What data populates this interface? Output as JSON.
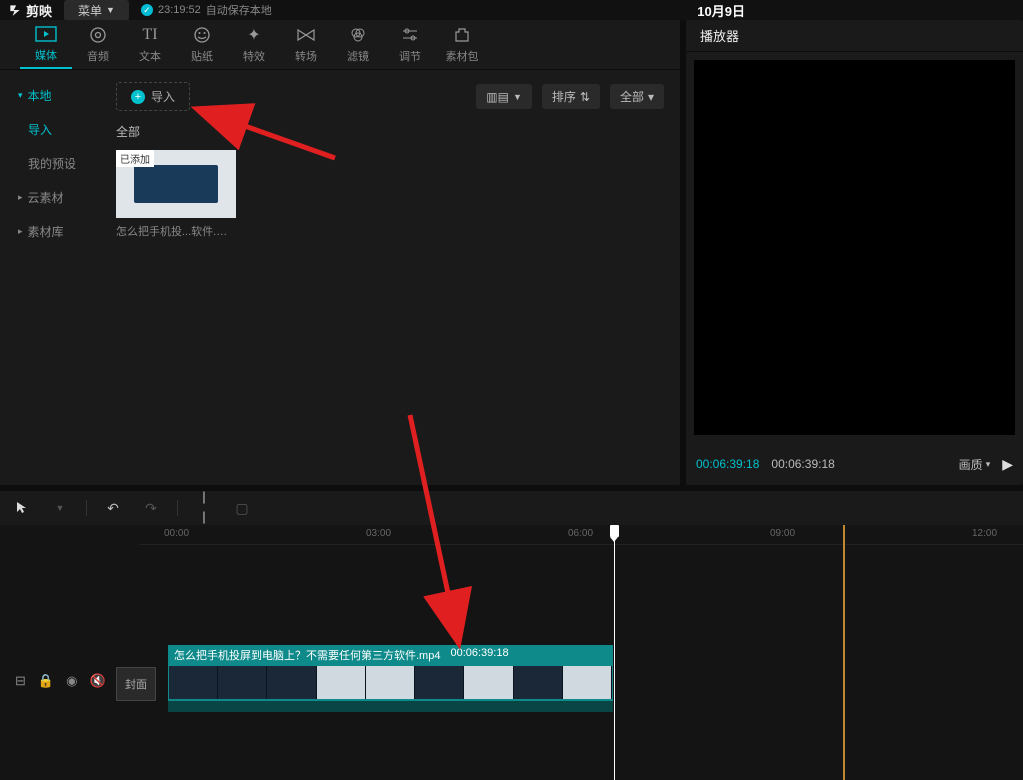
{
  "topbar": {
    "app_name": "剪映",
    "menu_label": "菜单",
    "save_time": "23:19:52",
    "save_text": "自动保存本地",
    "project_title": "10月9日"
  },
  "categories": [
    {
      "label": "媒体",
      "icon": "media"
    },
    {
      "label": "音频",
      "icon": "audio"
    },
    {
      "label": "文本",
      "icon": "text"
    },
    {
      "label": "贴纸",
      "icon": "sticker"
    },
    {
      "label": "特效",
      "icon": "effect"
    },
    {
      "label": "转场",
      "icon": "transition"
    },
    {
      "label": "滤镜",
      "icon": "filter"
    },
    {
      "label": "调节",
      "icon": "adjust"
    },
    {
      "label": "素材包",
      "icon": "pack"
    }
  ],
  "sidebar": {
    "items": [
      {
        "label": "本地",
        "active": true,
        "arrow": true
      },
      {
        "label": "导入",
        "active": true,
        "indent": true
      },
      {
        "label": "我的预设",
        "indent": true
      },
      {
        "label": "云素材",
        "arrow": true
      },
      {
        "label": "素材库",
        "arrow": true
      }
    ]
  },
  "content": {
    "import_label": "导入",
    "all_label": "全部",
    "sort_label": "排序",
    "filter_all_label": "全部",
    "media_badge": "已添加",
    "media_name": "怎么把手机投...软件.mp4"
  },
  "player": {
    "title": "播放器",
    "current": "00:06:39:18",
    "total": "00:06:39:18",
    "quality_label": "画质"
  },
  "timeline": {
    "marks": [
      "00:00",
      "03:00",
      "06:00",
      "09:00",
      "12:00"
    ],
    "cover_label": "封面",
    "clip_title": "怎么把手机投屏到电脑上？不需要任何第三方软件.mp4",
    "clip_duration": "00:06:39:18"
  }
}
